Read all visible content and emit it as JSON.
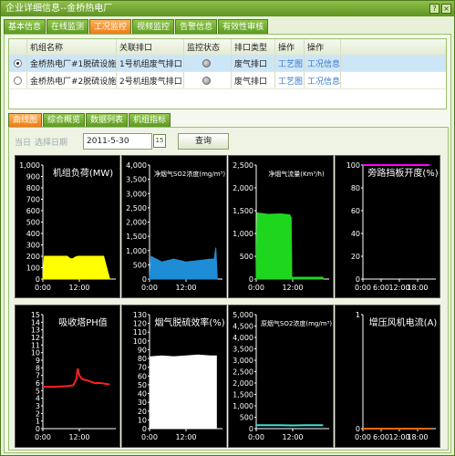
{
  "window": {
    "title": "企业详细信息--金桥热电厂",
    "btn_help": "?",
    "btn_close": "×"
  },
  "main_tabs": [
    {
      "label": "基本信息"
    },
    {
      "label": "在线监测"
    },
    {
      "label": "工况监控"
    },
    {
      "label": "视频监控"
    },
    {
      "label": "告警信息"
    },
    {
      "label": "有效性审核"
    }
  ],
  "grid": {
    "headers": [
      "机组名称",
      "关联排口",
      "监控状态",
      "排口类型",
      "操作",
      "操作"
    ],
    "rows": [
      {
        "unit": "金桥热电厂#1脱硫设施",
        "outlet": "1号机组废气排口",
        "type": "废气排口",
        "op1": "工艺图",
        "op2": "工况信息"
      },
      {
        "unit": "金桥热电厂#2脱硫设施",
        "outlet": "2号机组废气排口",
        "type": "废气排口",
        "op1": "工艺图",
        "op2": "工况信息"
      }
    ]
  },
  "sub_tabs": [
    {
      "label": "曲线图"
    },
    {
      "label": "综合概览"
    },
    {
      "label": "数据列表"
    },
    {
      "label": "机组指标"
    }
  ],
  "filter": {
    "today": "当日",
    "choose": "选择日期",
    "date": "2011-5-30",
    "calendar": "15",
    "query": "查询"
  },
  "chart_data": [
    {
      "type": "area",
      "title": "机组负荷(MW)",
      "color": "#ffff00",
      "yticks": [
        "1,000",
        "900",
        "800",
        "700",
        "600",
        "500",
        "400",
        "300",
        "200",
        "100",
        "0"
      ],
      "ylim": [
        0,
        1000
      ],
      "xticks": [
        "0:00",
        "12:00"
      ],
      "x_hours": [
        0,
        0.5,
        8,
        8.5,
        9,
        9.5,
        10,
        10.5,
        11,
        11.5,
        14,
        20,
        22
      ],
      "values": [
        0,
        200,
        200,
        190,
        180,
        178,
        180,
        190,
        195,
        200,
        200,
        200,
        0
      ]
    },
    {
      "type": "area",
      "title": "净烟气SO2浓度(mg/m³)",
      "color": "#1f8dd6",
      "yticks": [
        "4,000",
        "3,500",
        "3,000",
        "2,500",
        "2,000",
        "1,500",
        "1,000",
        "500",
        "0"
      ],
      "ylim": [
        0,
        4000
      ],
      "xticks": [
        "0:00",
        "12:00"
      ],
      "x_hours": [
        0,
        0.5,
        4,
        8,
        12,
        16,
        20,
        21.3,
        21.8,
        22.3
      ],
      "values": [
        0,
        800,
        600,
        700,
        600,
        650,
        700,
        700,
        1100,
        0
      ]
    },
    {
      "type": "area",
      "title": "净烟气流量(Km³/h)",
      "color": "#1fd61f",
      "yticks": [
        "2,500",
        "2,000",
        "1,500",
        "1,000",
        "500",
        "0"
      ],
      "ylim": [
        0,
        2500
      ],
      "xticks": [
        "0:00",
        "12:00"
      ],
      "x_hours": [
        0,
        0.3,
        4,
        8,
        11,
        11.5,
        11.7,
        22
      ],
      "values": [
        0,
        1450,
        1420,
        1430,
        1410,
        1350,
        40,
        40
      ]
    },
    {
      "type": "line",
      "title": "旁路挡板开度(%)",
      "color": "#ff00ff",
      "yticks": [
        "100",
        "80",
        "60",
        "40",
        "20",
        "0"
      ],
      "ylim": [
        0,
        100
      ],
      "xticks": [
        "0:00",
        "6:00",
        "12:00",
        "18:00"
      ],
      "x_hours": [
        0,
        22
      ],
      "values": [
        100,
        100
      ]
    },
    {
      "type": "line",
      "title": "吸收塔PH值",
      "color": "#ff2020",
      "yticks": [
        "15",
        "14",
        "13",
        "12",
        "11",
        "10",
        "9",
        "8",
        "7",
        "6",
        "5",
        "4",
        "3",
        "2",
        "1",
        "0"
      ],
      "ylim": [
        0,
        15
      ],
      "xticks": [
        "0:00",
        "12:00"
      ],
      "x_hours": [
        0,
        4,
        8,
        10,
        11,
        11.5,
        12,
        13,
        15,
        17,
        19,
        22
      ],
      "values": [
        5.5,
        5.5,
        5.6,
        5.7,
        6.5,
        7.9,
        7.0,
        6.5,
        6.3,
        6.0,
        6.0,
        5.8
      ]
    },
    {
      "type": "area",
      "title": "烟气脱硫效率(%)",
      "color": "#ffffff",
      "yticks": [
        "130",
        "120",
        "110",
        "100",
        "90",
        "80",
        "70",
        "60",
        "50",
        "40",
        "30",
        "20",
        "10",
        "0"
      ],
      "ylim": [
        0,
        130
      ],
      "xticks": [
        "0:00",
        "12:00"
      ],
      "x_hours": [
        0,
        0.3,
        4,
        8,
        12,
        16,
        20,
        22
      ],
      "values": [
        0,
        82,
        83,
        82,
        83,
        84,
        83,
        83
      ]
    },
    {
      "type": "line",
      "title": "原烟气SO2浓度(mg/m³)",
      "color": "#40e0d0",
      "yticks": [
        "5,000",
        "4,500",
        "4,000",
        "3,500",
        "3,000",
        "2,500",
        "2,000",
        "1,500",
        "1,000",
        "500",
        "0"
      ],
      "ylim": [
        0,
        5000
      ],
      "xticks": [
        "0:00",
        "12:00"
      ],
      "x_hours": [
        0,
        4,
        8,
        12,
        16,
        22
      ],
      "values": [
        150,
        150,
        150,
        140,
        150,
        150
      ]
    },
    {
      "type": "line",
      "title": "增压风机电流(A)",
      "color": "#ff6600",
      "yticks": [
        "1",
        "0"
      ],
      "ylim": [
        0,
        1
      ],
      "xticks": [
        "0:00",
        "6:00",
        "12:00",
        "18:00"
      ],
      "x_hours": [
        0,
        22
      ],
      "values": [
        0,
        0
      ]
    }
  ]
}
